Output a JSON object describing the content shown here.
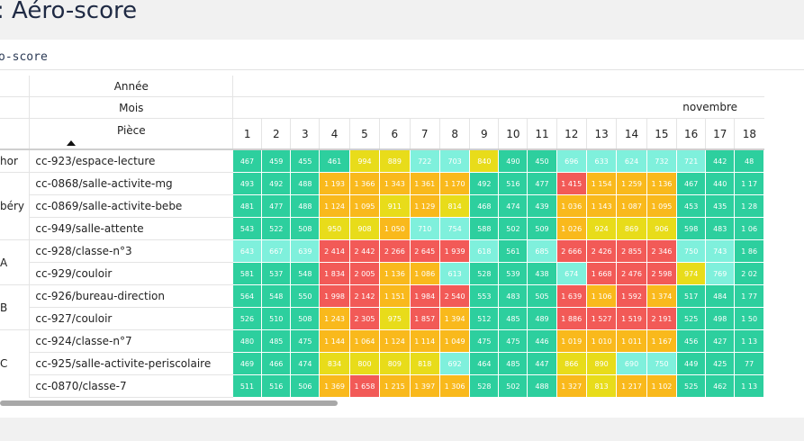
{
  "page": {
    "title": ": Aéro-score"
  },
  "panel": {
    "title": "o-score"
  },
  "pivot": {
    "dimensions": {
      "year": "Année",
      "month": "Mois",
      "room": "Pièce"
    },
    "month_name": "novembre",
    "days": [
      "1",
      "2",
      "3",
      "4",
      "5",
      "6",
      "7",
      "8",
      "9",
      "10",
      "11",
      "12",
      "13",
      "14",
      "15",
      "16",
      "17",
      "18"
    ],
    "groups": [
      {
        "school": "hor",
        "rooms": [
          "cc-923/espace-lecture"
        ]
      },
      {
        "school": "béry",
        "rooms": [
          "cc-0868/salle-activite-mg",
          "cc-0869/salle-activite-bebe",
          "cc-949/salle-attente"
        ]
      },
      {
        "school": "A",
        "rooms": [
          "cc-928/classe-n°3",
          "cc-929/couloir"
        ]
      },
      {
        "school": "B",
        "rooms": [
          "cc-926/bureau-direction",
          "cc-927/couloir"
        ]
      },
      {
        "school": "C",
        "rooms": [
          "cc-924/classe-n°7",
          "cc-925/salle-activite-periscolaire",
          "cc-0870/classe-7"
        ]
      }
    ],
    "values": [
      [
        "467",
        "459",
        "455",
        "461",
        "994",
        "889",
        "722",
        "703",
        "840",
        "490",
        "450",
        "696",
        "633",
        "624",
        "732",
        "721",
        "442",
        "48"
      ],
      [
        "493",
        "492",
        "488",
        "1 193",
        "1 366",
        "1 343",
        "1 361",
        "1 170",
        "492",
        "516",
        "477",
        "1 415",
        "1 154",
        "1 259",
        "1 136",
        "467",
        "440",
        "1 17"
      ],
      [
        "481",
        "477",
        "488",
        "1 124",
        "1 095",
        "911",
        "1 129",
        "814",
        "468",
        "474",
        "439",
        "1 036",
        "1 143",
        "1 087",
        "1 095",
        "453",
        "435",
        "1 28"
      ],
      [
        "543",
        "522",
        "508",
        "950",
        "908",
        "1 050",
        "710",
        "754",
        "588",
        "502",
        "509",
        "1 026",
        "924",
        "869",
        "906",
        "598",
        "483",
        "1 06"
      ],
      [
        "643",
        "667",
        "639",
        "2 414",
        "2 442",
        "2 266",
        "2 645",
        "1 939",
        "618",
        "561",
        "685",
        "2 666",
        "2 426",
        "2 855",
        "2 346",
        "750",
        "743",
        "1 86"
      ],
      [
        "581",
        "537",
        "548",
        "1 834",
        "2 005",
        "1 136",
        "1 086",
        "613",
        "528",
        "539",
        "438",
        "674",
        "1 668",
        "2 476",
        "2 598",
        "974",
        "769",
        "2 02"
      ],
      [
        "564",
        "548",
        "550",
        "1 998",
        "2 142",
        "1 151",
        "1 984",
        "2 540",
        "553",
        "483",
        "505",
        "1 639",
        "1 106",
        "1 592",
        "1 374",
        "517",
        "484",
        "1 77"
      ],
      [
        "526",
        "510",
        "508",
        "1 243",
        "2 305",
        "975",
        "1 857",
        "1 394",
        "512",
        "485",
        "489",
        "1 886",
        "1 527",
        "1 519",
        "2 191",
        "525",
        "498",
        "1 50"
      ],
      [
        "480",
        "485",
        "475",
        "1 144",
        "1 064",
        "1 124",
        "1 114",
        "1 049",
        "475",
        "475",
        "446",
        "1 019",
        "1 010",
        "1 011",
        "1 167",
        "456",
        "427",
        "1 13"
      ],
      [
        "469",
        "466",
        "474",
        "834",
        "800",
        "809",
        "818",
        "692",
        "464",
        "485",
        "447",
        "866",
        "890",
        "690",
        "750",
        "449",
        "425",
        "77"
      ],
      [
        "511",
        "516",
        "506",
        "1 369",
        "1 658",
        "1 215",
        "1 397",
        "1 306",
        "528",
        "502",
        "488",
        "1 327",
        "813",
        "1 217",
        "1 102",
        "525",
        "462",
        "1 13"
      ]
    ],
    "colors": {
      "good": "#2dcf9e",
      "fair": "#7ff0dc",
      "moderate": "#e8dc1a",
      "poor": "#f9b91c",
      "bad": "#f25a57"
    }
  }
}
